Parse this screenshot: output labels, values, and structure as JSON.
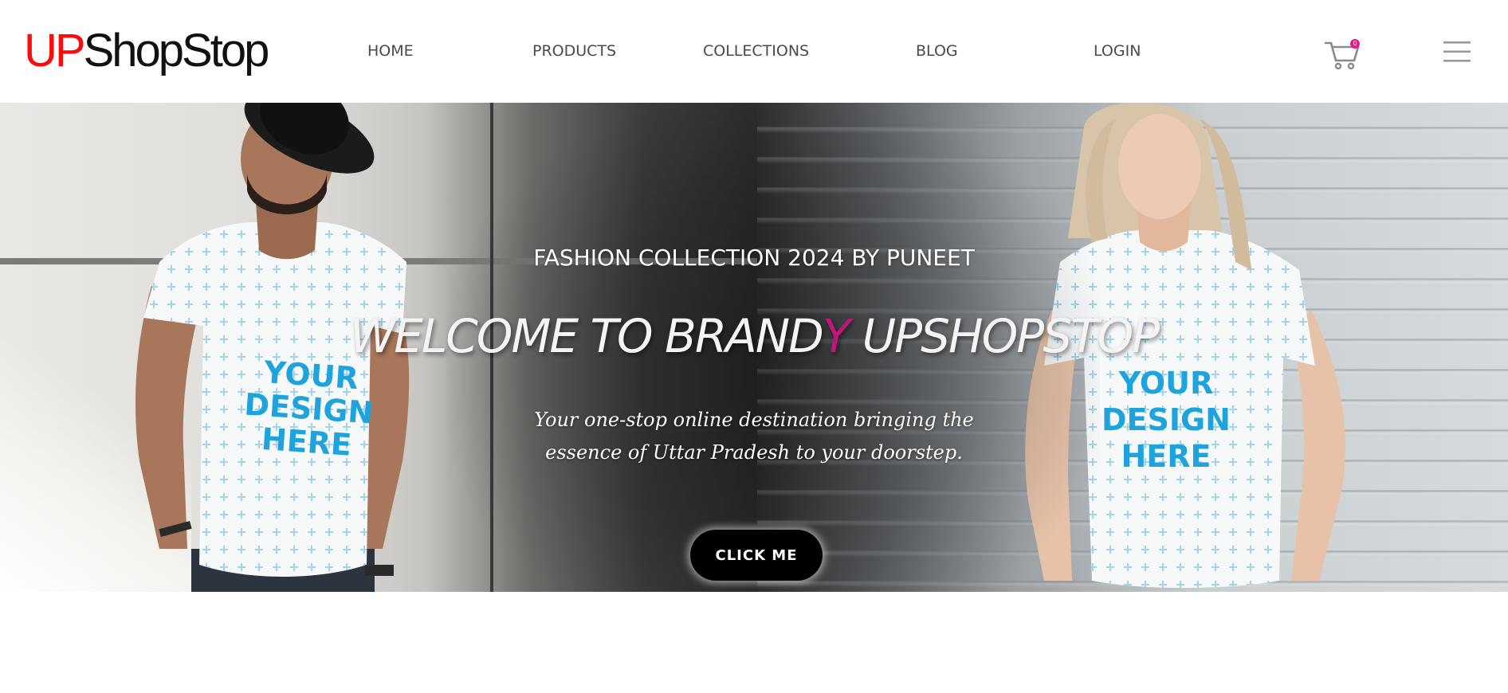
{
  "header": {
    "logo": {
      "part1": "UP",
      "part2": "ShopStop"
    },
    "nav": [
      {
        "label": "HOME"
      },
      {
        "label": "PRODUCTS"
      },
      {
        "label": "COLLECTIONS"
      },
      {
        "label": "BLOG"
      },
      {
        "label": "LOGIN"
      }
    ],
    "cart_count": "0"
  },
  "hero": {
    "eyebrow": "FASHION COLLECTION 2024 BY PUNEET",
    "title_part1": "WELCOME TO BRAND",
    "title_accent": "Y",
    "title_part2": " UPSHOPSTOP",
    "subtitle_line1": "Your one-stop online destination bringing the",
    "subtitle_line2": "essence of Uttar Pradesh to your doorstep.",
    "button_label": "CLICK ME",
    "shirt_print": [
      "YOUR",
      "DESIGN",
      "HERE"
    ]
  },
  "colors": {
    "logo_red": "#ff0a0a",
    "accent_magenta": "#c2157a",
    "badge_pink": "#e6198a",
    "shirt_print_blue": "#1fa3dc",
    "nav_text": "#4a4a4a"
  },
  "icons": {
    "cart": "shopping-cart-icon",
    "menu": "hamburger-menu-icon"
  }
}
